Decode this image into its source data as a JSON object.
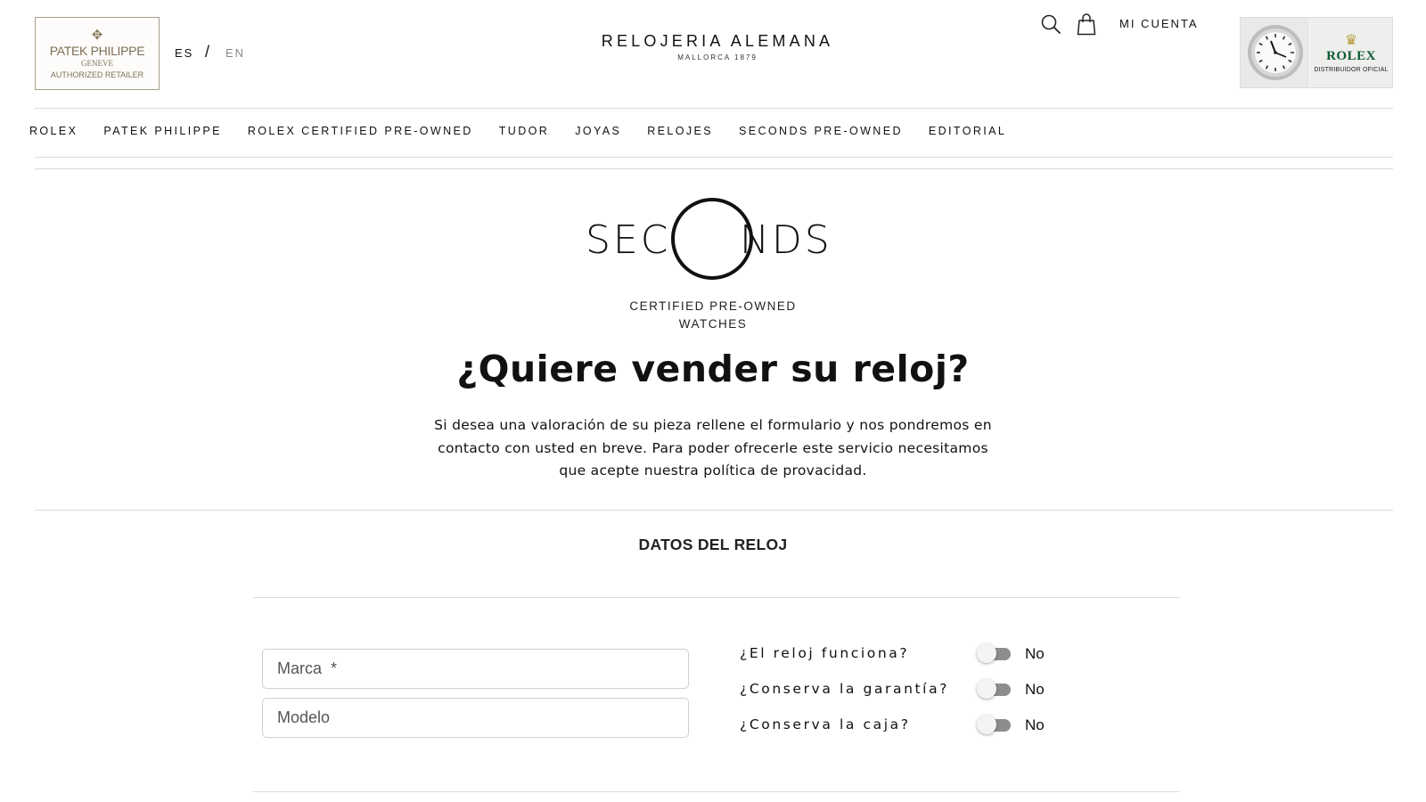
{
  "header": {
    "patek_badge": {
      "name": "PATEK PHILIPPE",
      "city": "GENEVE",
      "retailer": "AUTHORIZED RETAILER"
    },
    "languages": {
      "es": "ES",
      "separator": "/",
      "en": "EN"
    },
    "brand": {
      "name": "RELOJERIA ALEMANA",
      "sub": "MALLORCA 1879"
    },
    "account_label": "MI CUENTA",
    "rolex_badge": {
      "brand": "ROLEX",
      "label": "DISTRIBUIDOR OFICIAL"
    }
  },
  "nav": {
    "items": [
      "ROLEX",
      "PATEK PHILIPPE",
      "ROLEX CERTIFIED PRE-OWNED",
      "TUDOR",
      "JOYAS",
      "RELOJES",
      "SECONDS PRE-OWNED",
      "EDITORIAL"
    ]
  },
  "hero": {
    "logo_left": "SEC",
    "logo_right": "NDS",
    "logo_sub1": "CERTIFIED PRE-OWNED",
    "logo_sub2": "WATCHES",
    "title": "¿Quiere vender su reloj?",
    "intro": "Si desea una valoración de su pieza rellene el formulario y nos pondremos en contacto con usted en breve. Para poder ofrecerle este servicio necesitamos que acepte nuestra política de provacidad."
  },
  "form": {
    "section_title": "DATOS DEL RELOJ",
    "fields": {
      "marca_placeholder": "Marca  *",
      "modelo_placeholder": "Modelo"
    },
    "questions": [
      {
        "label": "¿El reloj funciona?",
        "value": "No",
        "checked": false
      },
      {
        "label": "¿Conserva la garantía?",
        "value": "No",
        "checked": false
      },
      {
        "label": "¿Conserva la caja?",
        "value": "No",
        "checked": false
      }
    ]
  },
  "colors": {
    "rolex_green": "#0e5a33",
    "patek_gold": "#7d6f55",
    "toggle_track": "#8d8d8d"
  }
}
